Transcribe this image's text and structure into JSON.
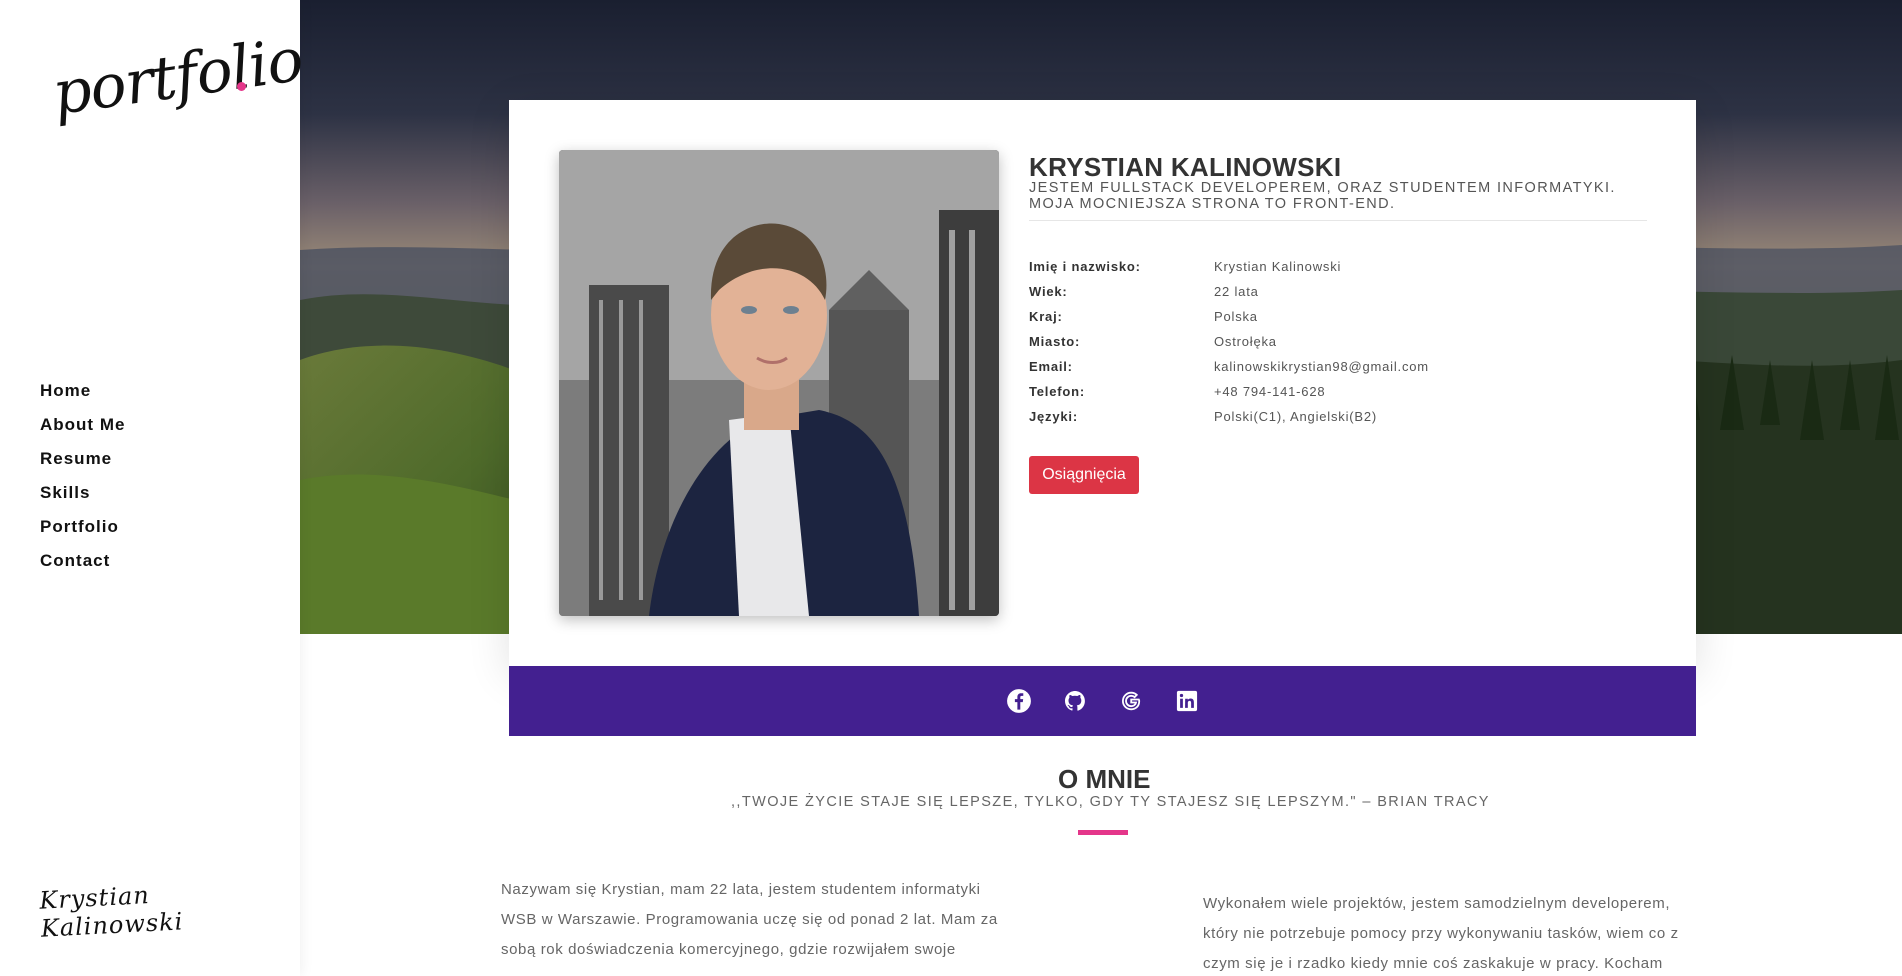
{
  "sidebar": {
    "logo_text": "portfolio",
    "nav": [
      "Home",
      "About Me",
      "Resume",
      "Skills",
      "Portfolio",
      "Contact"
    ],
    "signature": "Krystian Kalinowski"
  },
  "profile": {
    "name": "KRYSTIAN KALINOWSKI",
    "subtitle_line1": "JESTEM FULLSTACK DEVELOPEREM, ORAZ STUDENTEM INFORMATYKI.",
    "subtitle_line2": "MOJA MOCNIEJSZA STRONA TO FRONT-END.",
    "info": [
      {
        "label": "Imię i nazwisko:",
        "value": "Krystian Kalinowski"
      },
      {
        "label": "Wiek:",
        "value": "22 lata"
      },
      {
        "label": "Kraj:",
        "value": "Polska"
      },
      {
        "label": "Miasto:",
        "value": "Ostrołęka"
      },
      {
        "label": "Email:",
        "value": "kalinowskikrystian98@gmail.com"
      },
      {
        "label": "Telefon:",
        "value": "+48 794-141-628"
      },
      {
        "label": "Języki:",
        "value": "Polski(C1), Angielski(B2)"
      }
    ],
    "button_label": "Osiągnięcia"
  },
  "social": {
    "icons": [
      "facebook-icon",
      "github-icon",
      "google-icon",
      "linkedin-icon"
    ],
    "bar_color": "#432090"
  },
  "about": {
    "title": "O MNIE",
    "quote": ",,TWOJE ŻYCIE STAJE SIĘ LEPSZE, TYLKO, GDY TY STAJESZ SIĘ LEPSZYM.\" – BRIAN TRACY",
    "left_lines": [
      "Nazywam się Krystian, mam 22 lata, jestem studentem informatyki",
      "WSB w Warszawie. Programowania uczę się od ponad 2 lat. Mam za",
      "sobą rok doświadczenia komercyjnego, gdzie rozwijałem swoje"
    ],
    "right_lines": [
      "Wykonałem wiele projektów, jestem samodzielnym developerem,",
      "który nie potrzebuje pomocy przy wykonywaniu tasków, wiem co z",
      "czym się je i rzadko kiedy mnie coś zaskakuje w pracy. Kocham"
    ]
  },
  "colors": {
    "accent_pink": "#e4368a",
    "button_red": "#dc3545"
  }
}
